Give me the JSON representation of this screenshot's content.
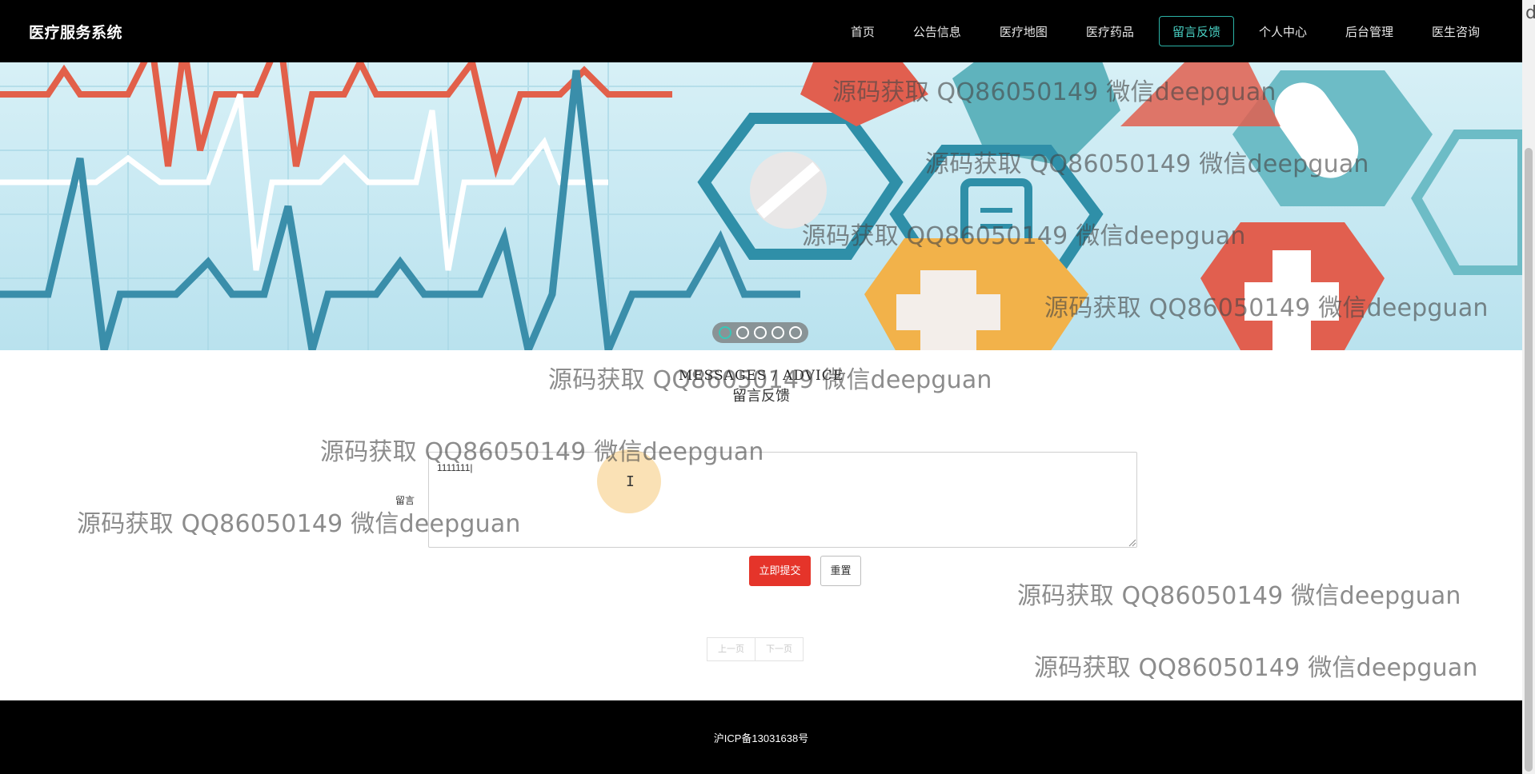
{
  "header": {
    "brand": "医疗服务系统",
    "nav": [
      {
        "label": "首页"
      },
      {
        "label": "公告信息"
      },
      {
        "label": "医疗地图"
      },
      {
        "label": "医疗药品"
      },
      {
        "label": "留言反馈",
        "active": true
      },
      {
        "label": "个人中心"
      },
      {
        "label": "后台管理"
      },
      {
        "label": "医生咨询"
      }
    ]
  },
  "carousel": {
    "slide_count": 5,
    "active_index": 0
  },
  "section": {
    "title_en": "MESSAGES / ADVICE",
    "title_cn": "留言反馈"
  },
  "form": {
    "message_label": "留言",
    "message_value": "1111111",
    "submit_label": "立即提交",
    "reset_label": "重置"
  },
  "pagination": {
    "prev_label": "上一页",
    "next_label": "下一页"
  },
  "footer": {
    "icp": "沪ICP备13031638号"
  },
  "watermark": {
    "text": "源码获取 QQ86050149 微信deepguan"
  },
  "corner_letter": "d",
  "colors": {
    "header_bg": "#000000",
    "active_nav": "#2bb3a6",
    "submit_button": "#e5342a",
    "footer_bg": "#000000"
  }
}
